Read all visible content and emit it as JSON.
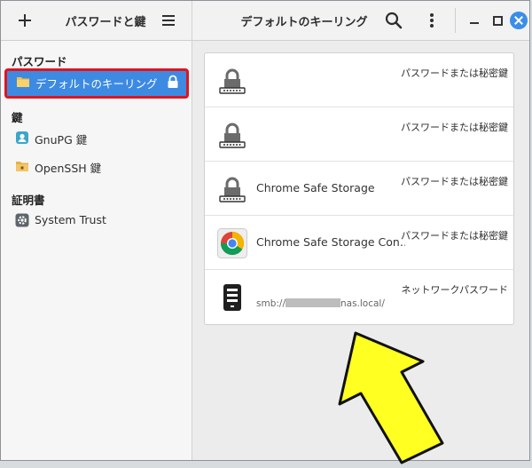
{
  "header": {
    "app_title": "パスワードと鍵",
    "window_title": "デフォルトのキーリング"
  },
  "sidebar": {
    "passwords_heading": "パスワード",
    "keys_heading": "鍵",
    "certs_heading": "証明書",
    "items": [
      {
        "label": "デフォルトのキーリング",
        "icon": "folder-icon",
        "selected": true
      },
      {
        "label": "GnuPG 鍵",
        "icon": "gnupg-icon"
      },
      {
        "label": "OpenSSH 鍵",
        "icon": "ssh-folder-icon"
      },
      {
        "label": "System Trust",
        "icon": "gear-icon"
      }
    ]
  },
  "entries": [
    {
      "name": "",
      "type": "パスワードまたは秘密鍵",
      "icon": "keyring-icon"
    },
    {
      "name": "",
      "type": "パスワードまたは秘密鍵",
      "icon": "keyring-icon"
    },
    {
      "name": "Chrome Safe Storage",
      "type": "パスワードまたは秘密鍵",
      "icon": "keyring-icon"
    },
    {
      "name": "Chrome Safe Storage Con…",
      "type": "パスワードまたは秘密鍵",
      "icon": "chrome-icon"
    },
    {
      "name": "",
      "subtitle_prefix": "smb://",
      "subtitle_suffix": "nas.local/",
      "type": "ネットワークパスワード",
      "icon": "server-icon"
    }
  ],
  "colors": {
    "accent": "#3d8ae3",
    "highlight_border": "#e0141e",
    "annotation_arrow": "#ffff22"
  }
}
